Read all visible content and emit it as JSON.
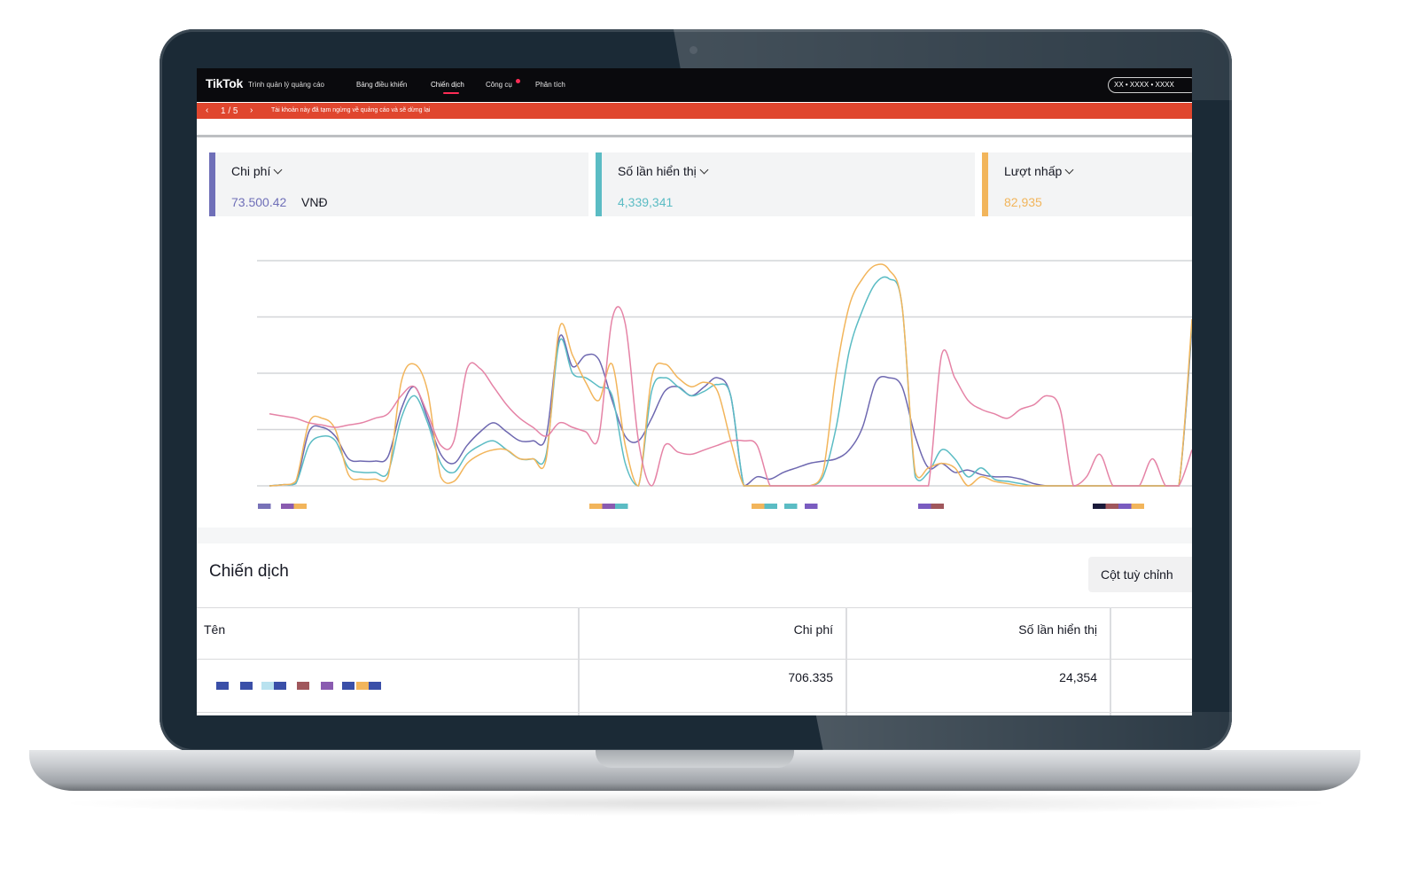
{
  "header": {
    "logo": "TikTok",
    "subtitle": "Trình quản lý quảng cáo",
    "nav": [
      {
        "label": "Bảng điều khiển"
      },
      {
        "label": "Chiến dịch",
        "active": true
      },
      {
        "label": "Công cụ",
        "badge": true
      },
      {
        "label": "Phân tích"
      }
    ],
    "account": "XX • XXXX • XXXX"
  },
  "alert": {
    "page": "1 / 5",
    "text": "Tài khoản này đã tạm ngừng về quảng cáo và sẽ dừng lại"
  },
  "metrics": [
    {
      "label": "Chi phí",
      "value": "73.500.42",
      "unit": "VNĐ",
      "color": "#6f6fb8"
    },
    {
      "label": "Số lần hiển thị",
      "value": "4,339,341",
      "color": "#5bbcc4"
    },
    {
      "label": "Lượt nhấp",
      "value": "82,935",
      "color": "#f2b55b"
    }
  ],
  "chart_data": {
    "type": "line",
    "series": [
      {
        "color": "#6e68b0",
        "values": [
          0,
          0.5,
          1,
          24,
          26,
          22,
          12,
          11,
          11,
          13,
          34,
          44,
          30,
          14,
          10,
          18,
          24,
          28,
          24,
          20,
          20,
          22,
          66,
          53,
          58,
          56,
          38,
          22,
          20,
          30,
          42,
          44,
          40,
          44,
          48,
          40,
          0,
          4,
          3,
          6,
          8,
          10,
          11,
          12,
          16,
          26,
          46,
          48,
          44,
          22,
          8,
          10,
          6,
          7,
          5,
          4,
          4,
          3,
          1,
          0,
          0,
          0,
          0,
          0,
          0,
          0,
          0,
          0,
          0,
          0,
          70
        ]
      },
      {
        "color": "#5bbcc4",
        "values": [
          0,
          0.5,
          1,
          18,
          22,
          20,
          8,
          6,
          6,
          6,
          30,
          40,
          28,
          10,
          6,
          14,
          18,
          20,
          16,
          12,
          12,
          14,
          64,
          50,
          48,
          44,
          40,
          10,
          0,
          42,
          48,
          44,
          40,
          42,
          45,
          40,
          0,
          0,
          0,
          0,
          0,
          0,
          4,
          26,
          60,
          78,
          90,
          92,
          80,
          4,
          6,
          16,
          12,
          4,
          8,
          3,
          2,
          1,
          0,
          0,
          0,
          0,
          0,
          0,
          0,
          0,
          0,
          0,
          0,
          0,
          72
        ]
      },
      {
        "color": "#f2b55b",
        "values": [
          0,
          0.5,
          2,
          28,
          30,
          25,
          5,
          3,
          3,
          4,
          46,
          54,
          42,
          4,
          2,
          10,
          14,
          16,
          16,
          12,
          12,
          12,
          70,
          58,
          46,
          38,
          54,
          18,
          0,
          48,
          54,
          48,
          44,
          46,
          42,
          20,
          0,
          0,
          0,
          0,
          0,
          0,
          6,
          50,
          80,
          92,
          98,
          96,
          80,
          6,
          8,
          10,
          8,
          0,
          4,
          2,
          1,
          0,
          0,
          0,
          0,
          0,
          0,
          0,
          0,
          0,
          0,
          0,
          0,
          0,
          74
        ]
      },
      {
        "color": "#e583a6",
        "values": [
          32,
          31,
          30,
          28,
          27,
          26,
          27,
          28,
          30,
          32,
          40,
          44,
          32,
          18,
          20,
          52,
          52,
          44,
          36,
          30,
          26,
          22,
          28,
          26,
          24,
          22,
          74,
          72,
          20,
          0,
          18,
          15,
          14,
          16,
          18,
          20,
          20,
          18,
          0,
          0,
          0,
          0,
          0,
          0,
          0,
          0,
          0,
          0,
          0,
          0,
          0,
          58,
          48,
          38,
          34,
          32,
          30,
          34,
          36,
          40,
          34,
          0,
          4,
          14,
          0,
          0,
          0,
          12,
          0,
          0,
          16
        ]
      }
    ],
    "ylim": [
      0,
      100
    ],
    "grid": true,
    "legend_markers": [
      [
        "#7872b8"
      ],
      [
        "#8a5bb0",
        "#f2b55b"
      ],
      [
        "#f2b55b",
        "#8a5bb0",
        "#5bbcc4"
      ],
      [
        "#f2b55b",
        "#5bbcc4"
      ],
      [
        "#5bbcc4"
      ],
      [
        "#7a5cc0"
      ],
      [
        "#7a5cc0",
        "#a0575c"
      ],
      [
        "#1a1a3a",
        "#a0575c",
        "#7a5cc0",
        "#f2b55b"
      ]
    ]
  },
  "campaigns": {
    "title": "Chiến dịch",
    "custom_button": "Cột tuỳ chỉnh",
    "columns": [
      "Tên",
      "Chi phí",
      "Số lần hiển thị"
    ],
    "rows": [
      {
        "name_blocks": [
          "#3a4fa8",
          "#3a4fa8",
          "#b9e2ef",
          "#3a4fa8",
          "#a0575c",
          "#8a5bb0",
          "#3a4fa8",
          "#f2b55b",
          "#3a4fa8"
        ],
        "cost": "706.335",
        "impressions": "24,354"
      }
    ]
  }
}
